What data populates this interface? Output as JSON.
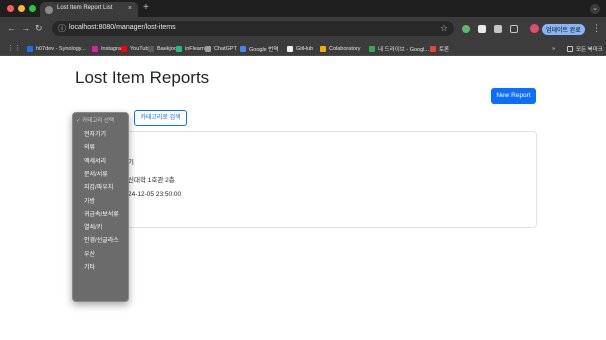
{
  "browser": {
    "tab_title": "Lost Item Report List",
    "tab_close": "×",
    "new_tab": "+",
    "url": "localhost:8080/manager/lost-items",
    "profile_label": "업데이트 완료",
    "bookmarks": [
      {
        "label": "h07dev - Synology...",
        "color": "#1a73e8"
      },
      {
        "label": "Instagram",
        "color": "#d6249f"
      },
      {
        "label": "YouTube",
        "color": "#ff0000"
      },
      {
        "label": "Baekjoon",
        "color": "#5b5b5b"
      },
      {
        "label": "inFlearn",
        "color": "#1dc078"
      },
      {
        "label": "ChatGPT",
        "color": "#9e9e9e"
      },
      {
        "label": "Google 번역",
        "color": "#4285f4"
      },
      {
        "label": "GitHub",
        "color": "#f0f0f0"
      },
      {
        "label": "Colaboratory",
        "color": "#f9ab00"
      },
      {
        "label": "내 드라이브 - Googl...",
        "color": "#34a853"
      },
      {
        "label": "토론",
        "color": "#e8453c"
      }
    ],
    "bookmark_more": "»",
    "all_bookmarks": "모든 북마크"
  },
  "page": {
    "title": "Lost Item Reports",
    "new_report_label": "New Report",
    "filter_button_label": "카테고리로 검색",
    "card_lines": [
      "기",
      "신대학 1호관 2층",
      "24-12-05 23:50:00"
    ]
  },
  "category_dropdown": {
    "selected": "✓ 카테고리 선택",
    "options": [
      "전자기기",
      "의류",
      "액세서리",
      "문서/서류",
      "지갑/파우치",
      "가방",
      "귀금속/보석류",
      "열쇠/키",
      "안경/선글라스",
      "우산",
      "기타"
    ]
  },
  "colors": {
    "primary": "#0d6efd",
    "chrome_dark": "#3c3c3c"
  }
}
